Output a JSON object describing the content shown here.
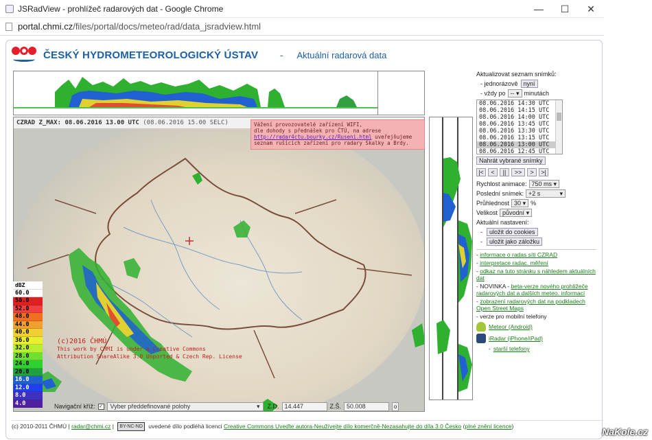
{
  "window": {
    "title": "JSRadView - prohlížeč radarových dat - Google Chrome",
    "minimize": "—",
    "maximize": "☐",
    "close": "✕"
  },
  "address": {
    "host": "portal.chmi.cz",
    "path": "/files/portal/docs/meteo/rad/data_jsradview.html"
  },
  "brand": {
    "title": "ČESKÝ HYDROMETEOROLOGICKÝ ÚSTAV",
    "separator": "-",
    "subtitle": "Aktuální radarová data"
  },
  "map": {
    "header_main": "CZRAD Z_MAX: 08.06.2016 13.00 UTC",
    "header_selc": " (08.06.2016 15.00 SELC)",
    "notice": {
      "line1": "Vážení provozovatelé zařízení WIFI,",
      "line2": "dle dohody s přednášek pro ČTÚ, na adrese",
      "link": "http://radar4ctu.bourky.cz/Ruseni.html",
      "line3_after": " uveřejňujeme",
      "line4": "seznam rušících zařízení pro radary Skalky a Brdy."
    },
    "watermark": {
      "line1": "(c)2016 ČHMÚ",
      "line2": "This work by CHMI is under a Creative Commons",
      "line3": "Attribution ShareAlike 3.0 Unported & Czech Rep. License"
    },
    "legend": {
      "header": "dBZ",
      "entries": [
        {
          "label": "60.0",
          "color": "#ffffff"
        },
        {
          "label": "56.0",
          "color": "#e02020"
        },
        {
          "label": "52.0",
          "color": "#f04040"
        },
        {
          "label": "48.0",
          "color": "#f07020"
        },
        {
          "label": "44.0",
          "color": "#f0a030"
        },
        {
          "label": "40.0",
          "color": "#f0d030"
        },
        {
          "label": "36.0",
          "color": "#e8f030"
        },
        {
          "label": "32.0",
          "color": "#b8f030"
        },
        {
          "label": "28.0",
          "color": "#70e030"
        },
        {
          "label": "24.0",
          "color": "#30d030"
        },
        {
          "label": "20.0",
          "color": "#20a040"
        },
        {
          "label": "16.0",
          "color": "#2060d0"
        },
        {
          "label": "12.0",
          "color": "#2040f0"
        },
        {
          "label": "8.0",
          "color": "#4030c0"
        },
        {
          "label": "4.0",
          "color": "#5020a0"
        }
      ],
      "scale": [
        "100",
        "10",
        "1",
        "0.1"
      ]
    },
    "nav": {
      "label": "Navigační kříž:",
      "select": "Vyber předdefinované polohy",
      "zd_label": "Z.D.",
      "zd_value": "14.447",
      "zs_label": "Z.Š.",
      "zs_value": "50.008",
      "o_button": "o"
    }
  },
  "panel": {
    "refresh_label": "Aktualizovat seznam snímků:",
    "once_label": "- jednorázově",
    "now_button": "nyní",
    "always_label": "- vždy po",
    "always_value": "--",
    "minutes": "minutách",
    "frames": [
      "08.06.2016 14:30 UTC",
      "08.06.2016 14:15 UTC",
      "08.06.2016 14:00 UTC",
      "08.06.2016 13:45 UTC",
      "08.06.2016 13:30 UTC",
      "08.06.2016 13:15 UTC",
      "08.06.2016 13:00 UTC",
      "08.06.2016 12:45 UTC"
    ],
    "selected_frame_index": 6,
    "load_button": "Nahrát vybrané snímky",
    "controls": [
      "|<",
      "<",
      "||",
      ">>",
      ">",
      ">|"
    ],
    "speed_label": "Rychlost animace:",
    "speed_value": "750 ms",
    "last_label": "Poslední snímek:",
    "last_value": "+2 s",
    "opacity_label": "Průhlednost",
    "opacity_value": "30",
    "opacity_unit": "%",
    "size_label": "Velikost",
    "size_value": "původní",
    "settings_label": "Aktuální nastavení:",
    "save_cookies": "uložit do cookies",
    "save_bookmark": "uložit jako záložku",
    "links": [
      {
        "prefix": "-",
        "text": "informace o radas síti CZRAD"
      },
      {
        "prefix": "-",
        "text": "interpretace radac. měření"
      },
      {
        "prefix": "-",
        "text": "odkaz na tuto stránku s náhledem aktuálních dat"
      },
      {
        "prefix": "- NOVINKA -",
        "text": "beta-verze nového prohlížeče radarových dat a dalších meteo. informací"
      },
      {
        "prefix": "-",
        "text": "zobrazení radarových dat na podkladech Open Street Maps"
      }
    ],
    "mobile_label": "- verze pro mobilní telefony",
    "android": "Meteor (Android)",
    "iradar": "iRadar (iPhone/iPad)",
    "older": "starší telefony"
  },
  "footer": {
    "copyright": "(c) 2010-2011 ČHMÚ |",
    "email": "radar@chmi.cz",
    "pipe": "|",
    "cc_badge": "BY-NC-ND",
    "licence_text": "uvedené dílo podléhá licenci",
    "licence_link": "Creative Commons Uveďte autora-Neužívejte dílo komerčně-Nezasahujte do díla 3.0 Česko",
    "full_text_link": "plné znění licence"
  },
  "watermark_site": "NaKole.cz"
}
